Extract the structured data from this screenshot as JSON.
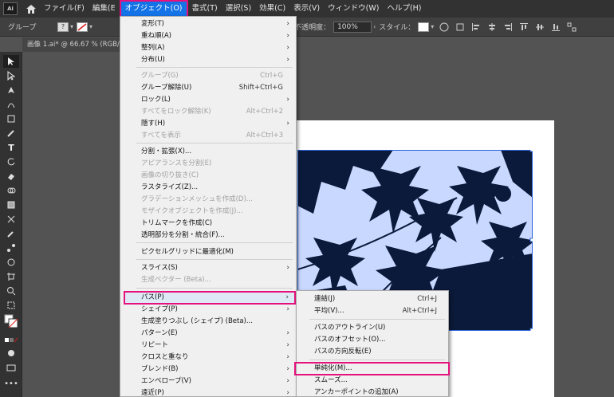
{
  "app": {
    "logo": "Ai"
  },
  "menubar": {
    "items": [
      "ファイル(F)",
      "編集(E",
      "オブジェクト(O)",
      "書式(T)",
      "選択(S)",
      "効果(C)",
      "表示(V)",
      "ウィンドウ(W)",
      "ヘルプ(H)"
    ],
    "active_index": 2
  },
  "controlbar": {
    "selection_type": "グループ",
    "stroke_box": "?",
    "opacity_label": "不透明度：",
    "opacity_value": "100%",
    "style_label": "スタイル：",
    "left_char": "本"
  },
  "document_tab": {
    "title": "画像 1.ai* @ 66.67 % (RGB/プレビ"
  },
  "object_menu": {
    "items": [
      {
        "label": "変形(T)",
        "shortcut": "",
        "submenu": true,
        "enabled": true
      },
      {
        "label": "重ね順(A)",
        "shortcut": "",
        "submenu": true,
        "enabled": true
      },
      {
        "label": "整列(A)",
        "shortcut": "",
        "submenu": true,
        "enabled": true
      },
      {
        "label": "分布(U)",
        "shortcut": "",
        "submenu": true,
        "enabled": true
      },
      {
        "label": "グループ(G)",
        "shortcut": "Ctrl+G",
        "submenu": false,
        "enabled": false
      },
      {
        "label": "グループ解除(U)",
        "shortcut": "Shift+Ctrl+G",
        "submenu": false,
        "enabled": true
      },
      {
        "label": "ロック(L)",
        "shortcut": "",
        "submenu": true,
        "enabled": true
      },
      {
        "label": "すべてをロック解除(K)",
        "shortcut": "Alt+Ctrl+2",
        "submenu": false,
        "enabled": false
      },
      {
        "label": "隠す(H)",
        "shortcut": "",
        "submenu": true,
        "enabled": true
      },
      {
        "label": "すべてを表示",
        "shortcut": "Alt+Ctrl+3",
        "submenu": false,
        "enabled": false
      },
      {
        "label": "分割・拡張(X)...",
        "shortcut": "",
        "submenu": false,
        "enabled": true
      },
      {
        "label": "アピアランスを分割(E)",
        "shortcut": "",
        "submenu": false,
        "enabled": false
      },
      {
        "label": "画像の切り抜き(C)",
        "shortcut": "",
        "submenu": false,
        "enabled": false
      },
      {
        "label": "ラスタライズ(Z)...",
        "shortcut": "",
        "submenu": false,
        "enabled": true
      },
      {
        "label": "グラデーションメッシュを作成(D)...",
        "shortcut": "",
        "submenu": false,
        "enabled": false
      },
      {
        "label": "モザイクオブジェクトを作成(J)...",
        "shortcut": "",
        "submenu": false,
        "enabled": false
      },
      {
        "label": "トリムマークを作成(C)",
        "shortcut": "",
        "submenu": false,
        "enabled": true
      },
      {
        "label": "透明部分を分割・統合(F)...",
        "shortcut": "",
        "submenu": false,
        "enabled": true
      },
      {
        "label": "ピクセルグリッドに最適化(M)",
        "shortcut": "",
        "submenu": false,
        "enabled": true
      },
      {
        "label": "スライス(S)",
        "shortcut": "",
        "submenu": true,
        "enabled": true
      },
      {
        "label": "生成ベクター (Beta)...",
        "shortcut": "",
        "submenu": false,
        "enabled": false
      },
      {
        "label": "パス(P)",
        "shortcut": "",
        "submenu": true,
        "enabled": true
      },
      {
        "label": "シェイプ(P)",
        "shortcut": "",
        "submenu": true,
        "enabled": true
      },
      {
        "label": "生成塗りつぶし (シェイプ) (Beta)...",
        "shortcut": "",
        "submenu": false,
        "enabled": true
      },
      {
        "label": "パターン(E)",
        "shortcut": "",
        "submenu": true,
        "enabled": true
      },
      {
        "label": "リピート",
        "shortcut": "",
        "submenu": true,
        "enabled": true
      },
      {
        "label": "クロスと重なり",
        "shortcut": "",
        "submenu": true,
        "enabled": true
      },
      {
        "label": "ブレンド(B)",
        "shortcut": "",
        "submenu": true,
        "enabled": true
      },
      {
        "label": "エンベロープ(V)",
        "shortcut": "",
        "submenu": true,
        "enabled": true
      },
      {
        "label": "遠近(P)",
        "shortcut": "",
        "submenu": true,
        "enabled": true
      }
    ]
  },
  "path_submenu": {
    "items": [
      {
        "label": "連結(J)",
        "shortcut": "Ctrl+J"
      },
      {
        "label": "平均(V)...",
        "shortcut": "Alt+Ctrl+J"
      },
      {
        "label": "パスのアウトライン(U)",
        "shortcut": ""
      },
      {
        "label": "パスのオフセット(O)...",
        "shortcut": ""
      },
      {
        "label": "パスの方向反転(E)",
        "shortcut": ""
      },
      {
        "label": "単純化(M)...",
        "shortcut": ""
      },
      {
        "label": "スムーズ...",
        "shortcut": ""
      },
      {
        "label": "アンカーポイントの追加(A)",
        "shortcut": ""
      }
    ]
  },
  "colors": {
    "highlight_border": "#e5127d",
    "artwork_fill": "#0b1a3a",
    "artwork_bg": "#c9d8ff"
  }
}
